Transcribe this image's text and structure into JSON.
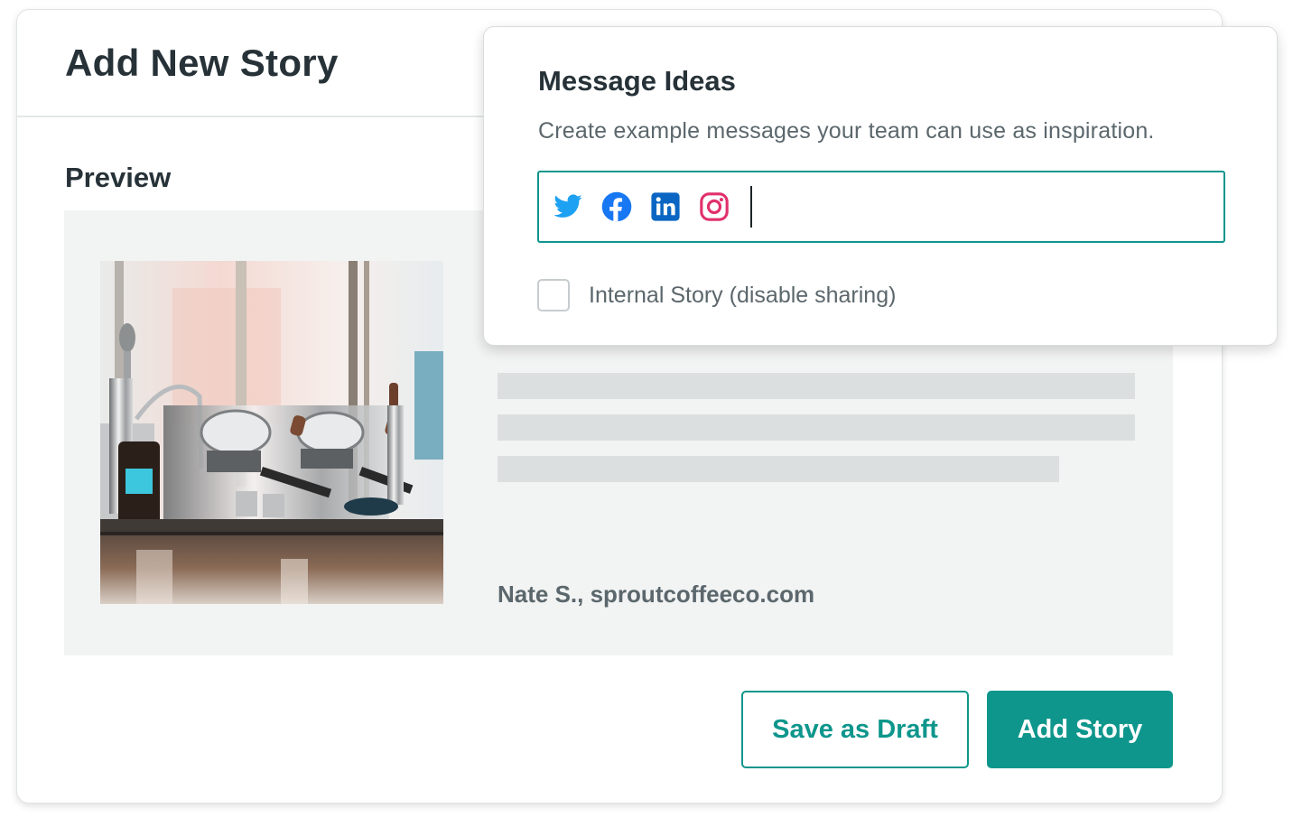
{
  "dialog": {
    "title": "Add New Story",
    "preview_label": "Preview",
    "attribution": "Nate S., sproutcoffeeco.com",
    "buttons": {
      "save_draft": "Save as Draft",
      "add_story": "Add Story"
    }
  },
  "message_ideas": {
    "title": "Message Ideas",
    "description": "Create example messages your team can use as inspiration.",
    "networks": [
      "twitter-icon",
      "facebook-icon",
      "linkedin-icon",
      "instagram-icon"
    ],
    "compose_value": "",
    "internal_story_label": "Internal Story (disable sharing)",
    "internal_story_checked": false
  },
  "colors": {
    "accent": "#0e968c",
    "twitter": "#1da1f2",
    "facebook": "#1877f2",
    "linkedin": "#0a66c2",
    "instagram": "#e1306c"
  }
}
